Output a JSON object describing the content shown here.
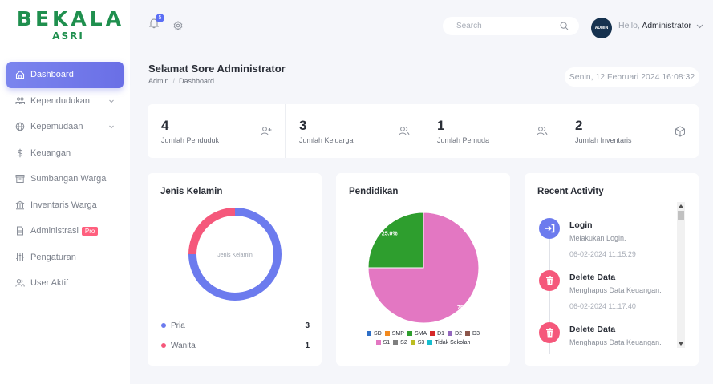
{
  "brand": {
    "name": "BEKALA",
    "sub": "ASRI"
  },
  "sidebar": {
    "items": [
      {
        "label": "Dashboard",
        "icon": "home-icon",
        "active": true
      },
      {
        "label": "Kependudukan",
        "icon": "people-icon",
        "chevron": true
      },
      {
        "label": "Kepemudaan",
        "icon": "globe-icon",
        "chevron": true
      },
      {
        "label": "Keuangan",
        "icon": "dollar-icon"
      },
      {
        "label": "Sumbangan Warga",
        "icon": "box-icon"
      },
      {
        "label": "Inventaris Warga",
        "icon": "building-icon"
      },
      {
        "label": "Administrasi",
        "icon": "document-icon",
        "badge": "Pro"
      },
      {
        "label": "Pengaturan",
        "icon": "sliders-icon"
      },
      {
        "label": "User Aktif",
        "icon": "user-icon"
      }
    ]
  },
  "topbar": {
    "notification_count": "5",
    "search_placeholder": "Search",
    "avatar_text": "ADMIN",
    "greeting": "Hello,",
    "user_name": "Administrator"
  },
  "page": {
    "title": "Selamat Sore Administrator",
    "breadcrumb": [
      "Admin",
      "Dashboard"
    ],
    "datetime": "Senin, 12 Februari 2024 16:08:32"
  },
  "stats": [
    {
      "value": "4",
      "label": "Jumlah Penduduk",
      "icon": "user-plus-icon"
    },
    {
      "value": "3",
      "label": "Jumlah Keluarga",
      "icon": "users-icon"
    },
    {
      "value": "1",
      "label": "Jumlah Pemuda",
      "icon": "users-icon"
    },
    {
      "value": "2",
      "label": "Jumlah Inventaris",
      "icon": "cube-icon"
    }
  ],
  "gender_card": {
    "title": "Jenis Kelamin",
    "center_label": "Jenis Kelamin",
    "items": [
      {
        "label": "Pria",
        "value": "3",
        "color": "#6c7bee"
      },
      {
        "label": "Wanita",
        "value": "1",
        "color": "#f5587b"
      }
    ]
  },
  "education_card": {
    "title": "Pendidikan"
  },
  "chart_data": [
    {
      "type": "pie",
      "title": "Jenis Kelamin",
      "variant": "donut",
      "categories": [
        "Pria",
        "Wanita"
      ],
      "values": [
        3,
        1
      ],
      "colors": [
        "#6c7bee",
        "#f5587b"
      ]
    },
    {
      "type": "pie",
      "title": "Pendidikan",
      "categories": [
        "SD",
        "SMP",
        "SMA",
        "D1",
        "D2",
        "D3",
        "S1",
        "S2",
        "S3",
        "Tidak Sekolah"
      ],
      "values": [
        0,
        0,
        1,
        0,
        0,
        0,
        3,
        0,
        0,
        0
      ],
      "colors": [
        "#2e6fc7",
        "#f28a1e",
        "#2e9e2e",
        "#d62728",
        "#9467bd",
        "#8c564b",
        "#e377c2",
        "#7f7f7f",
        "#bcbd22",
        "#17becf"
      ],
      "slice_labels": [
        "25.0%",
        "75.0%"
      ],
      "legend": "bottom"
    }
  ],
  "activity_card": {
    "title": "Recent Activity",
    "items": [
      {
        "title": "Login",
        "desc": "Melakukan Login.",
        "time": "06-02-2024 11:15:29",
        "icon": "login-icon",
        "color": "#6c7bee"
      },
      {
        "title": "Delete Data",
        "desc": "Menghapus Data Keuangan.",
        "time": "06-02-2024 11:17:40",
        "icon": "trash-icon",
        "color": "#f5587b"
      },
      {
        "title": "Delete Data",
        "desc": "Menghapus Data Keuangan.",
        "time": "",
        "icon": "trash-icon",
        "color": "#f5587b"
      }
    ]
  }
}
